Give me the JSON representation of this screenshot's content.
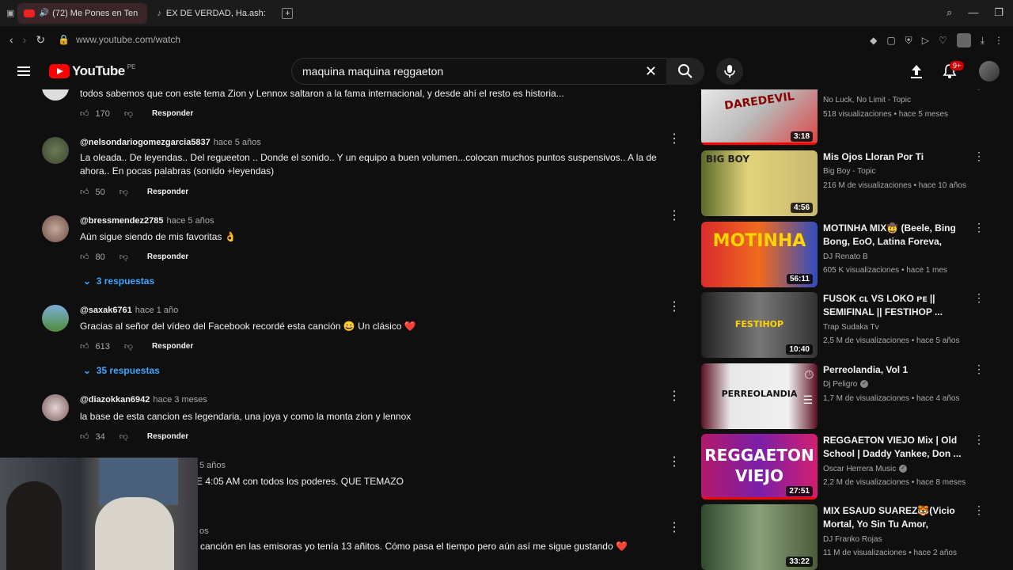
{
  "browser": {
    "tabs": [
      {
        "label": "(72) Me Pones en Ten",
        "active": true
      },
      {
        "label": "EX DE VERDAD, Ha.ash: A",
        "active": false
      }
    ],
    "url": "www.youtube.com/watch"
  },
  "youtube": {
    "logo": "YouTube",
    "country": "PE",
    "search_query": "maquina maquina reggaeton",
    "notifications_badge": "9+"
  },
  "comments": [
    {
      "text": "todos sabemos que con este tema Zion y Lennox saltaron a la fama internacional, y desde ahí el resto es historia...",
      "likes": "170",
      "reply_label": "Responder"
    },
    {
      "author": "@nelsondariogomezgarcia5837",
      "time": "hace 5 años",
      "text": "La oleada.. De leyendas.. Del regueeton .. Donde el sonido.. Y un equipo a buen volumen...colocan muchos puntos suspensivos.. A la de ahora.. En pocas palabras (sonido +leyendas)",
      "likes": "50",
      "reply_label": "Responder"
    },
    {
      "author": "@bressmendez2785",
      "time": "hace 5 años",
      "text": "Aún sigue siendo de mis favoritas 👌",
      "likes": "80",
      "reply_label": "Responder",
      "replies": "3 respuestas"
    },
    {
      "author": "@saxak6761",
      "time": "hace 1 año",
      "text": "Gracias al señor del vídeo del Facebook recordé esta canción 😄 Un clásico ❤️",
      "likes": "613",
      "reply_label": "Responder",
      "replies": "35 respuestas"
    },
    {
      "author": "@diazokkan6942",
      "time": "hace 3 meses",
      "text": "la base de esta cancion es legendaria, una joya y como la monta zion y lennox",
      "likes": "34",
      "reply_label": "Responder"
    },
    {
      "time": "5 años",
      "text": "E 4:05 AM con todos los poderes.  QUE TEMAZO"
    },
    {
      "time": "os",
      "text": "canción en las emisoras yo tenía 13 añitos. Cómo pasa el tiempo pero aún así me sigue gustando ❤️"
    }
  ],
  "sidebar": [
    {
      "title": "",
      "channel": "No Luck, No Limit - Topic",
      "meta": "518 visualizaciones • hace 5 meses",
      "duration": "3:18",
      "thumb_text": "DAREDEVIL"
    },
    {
      "title": "Mis Ojos Lloran Por Ti",
      "channel": "Big Boy - Topic",
      "meta": "216 M de visualizaciones • hace 10 años",
      "duration": "4:56",
      "thumb_text": "BIG BOY"
    },
    {
      "title": "MOTINHA MIX🤠 (Beele, Bing Bong, EoO, Latina Foreva, Bail...",
      "channel": "DJ Renato B",
      "meta": "605 K visualizaciones • hace 1 mes",
      "duration": "56:11",
      "thumb_text": "MOTINHA"
    },
    {
      "title": "FUSOK ᴄʟ VS LOKO ᴘᴇ || SEMIFINAL || FESTIHOP ...",
      "channel": "Trap Sudaka Tv",
      "meta": "2,5 M de visualizaciones • hace 5 años",
      "duration": "10:40",
      "thumb_text": "FESTIHOP"
    },
    {
      "title": "Perreolandia, Vol 1",
      "channel": "Dj Peligro",
      "meta": "1,7 M de visualizaciones • hace 4 años",
      "duration": "",
      "thumb_text": "PERREOLANDIA",
      "verified": true
    },
    {
      "title": "REGGAETON VIEJO Mix | Old School | Daddy Yankee, Don ...",
      "channel": "Oscar Herrera Music",
      "meta": "2,2 M de visualizaciones • hace 8 meses",
      "duration": "27:51",
      "thumb_text": "REGGAETON VIEJO",
      "verified": true
    },
    {
      "title": "MIX ESAUD SUAREZ🐯(Vicio Mortal, Yo Sin Tu Amor, Histori...",
      "channel": "DJ Franko Rojas",
      "meta": "11 M de visualizaciones • hace 2 años",
      "duration": "33:22",
      "thumb_text": ""
    }
  ]
}
